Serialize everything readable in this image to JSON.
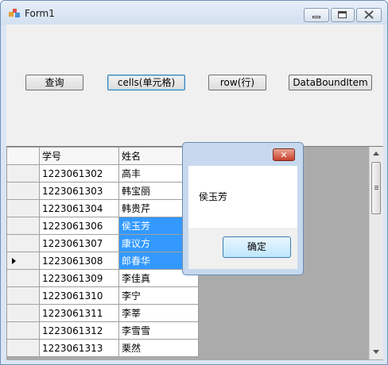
{
  "window": {
    "title": "Form1"
  },
  "buttons": {
    "query": "查询",
    "cells": "cells(单元格)",
    "row": "row(行)",
    "databound": "DataBoundItem"
  },
  "grid": {
    "columns": [
      "学号",
      "姓名"
    ],
    "rows": [
      [
        "1223061302",
        "高丰"
      ],
      [
        "1223061303",
        "韩宝丽"
      ],
      [
        "1223061304",
        "韩贵芹"
      ],
      [
        "1223061306",
        "侯玉芳"
      ],
      [
        "1223061307",
        "康议方"
      ],
      [
        "1223061308",
        "郎春华"
      ],
      [
        "1223061309",
        "李佳真"
      ],
      [
        "1223061310",
        "李宁"
      ],
      [
        "1223061311",
        "李莘"
      ],
      [
        "1223061312",
        "李雪雪"
      ],
      [
        "1223061313",
        "栗然"
      ]
    ],
    "selected_rows": [
      3,
      4,
      5
    ],
    "current_row": 5
  },
  "messagebox": {
    "text": "侯玉芳",
    "ok_label": "确定",
    "close_glyph": "✕"
  },
  "colors": {
    "selection": "#3399ff"
  }
}
